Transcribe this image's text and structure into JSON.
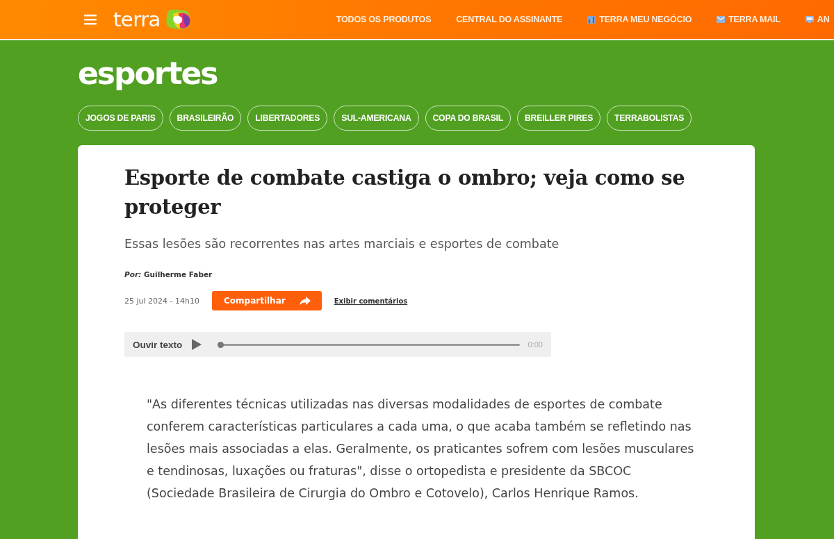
{
  "top_bar": {
    "logo": "terra",
    "links": [
      {
        "label": "TODOS OS PRODUTOS",
        "kind": "plain"
      },
      {
        "label": "CENTRAL DO ASSINANTE",
        "kind": "plain"
      },
      {
        "label": "TERRA MEU NEGÓCIO",
        "kind": "chart"
      },
      {
        "label": "TERRA MAIL",
        "kind": "mail"
      },
      {
        "label": "AN",
        "kind": "screen"
      }
    ]
  },
  "section": {
    "logo": "esportes",
    "tags": [
      "JOGOS DE PARIS",
      "BRASILEIRÃO",
      "LIBERTADORES",
      "SUL-AMERICANA",
      "COPA DO BRASIL",
      "BREILLER PIRES",
      "TERRABOLISTAS"
    ]
  },
  "article": {
    "title": "Esporte de combate castiga o ombro; veja como se proteger",
    "subtitle": "Essas lesões são recorrentes nas artes marciais e esportes de combate",
    "byline": "*Por:* **Guilherme Faber**",
    "date": "25 jul 2024 - 14h10",
    "share_button": "Compartilhar",
    "comments_link": "Exibir comentários",
    "audio_player": {
      "label": "Ouvir texto",
      "level": 0,
      "time": "0:00"
    },
    "quote": "\"As diferentes técnicas utilizadas nas diversas modalidades de esportes de combate conferem características particulares a cada uma, o que acaba também se refletindo nas lesões mais associadas a elas. Geralmente, os praticantes sofrem com lesões musculares e tendinosas, luxações ou fraturas\", disse o ortopedista e presidente da SBCOC (Sociedade Brasileira de Cirurgia do Ombro e Cotovelo), Carlos Henrique Ramos."
  }
}
